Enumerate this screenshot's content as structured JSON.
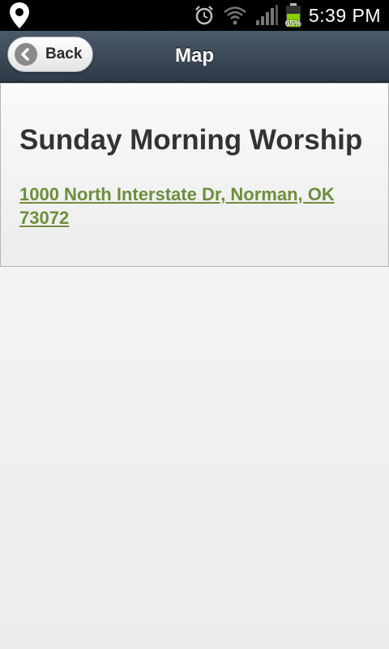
{
  "status_bar": {
    "time": "5:39 PM",
    "battery_percent": "65%",
    "battery_level": 0.65,
    "icons": [
      "location-pin-icon",
      "alarm-icon",
      "wifi-icon",
      "signal-icon",
      "battery-icon"
    ]
  },
  "header": {
    "title": "Map",
    "back_label": "Back"
  },
  "event": {
    "title": "Sunday Morning Worship",
    "address": "1000 North Interstate Dr, Norman, OK 73072"
  },
  "colors": {
    "link": "#6e8e3c",
    "header_bg": "#3b4856",
    "battery_fill": "#8ad100"
  }
}
